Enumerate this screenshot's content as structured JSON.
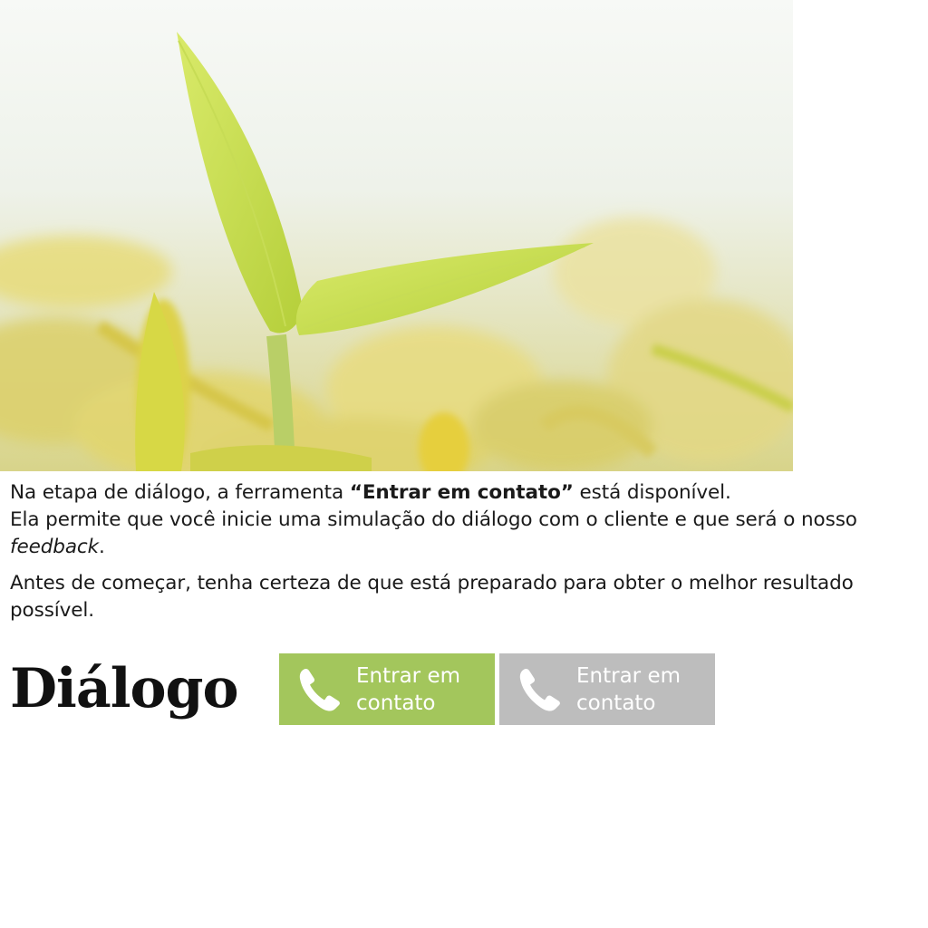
{
  "hero_image": {
    "alt": ""
  },
  "intro": {
    "line1_prefix": "Na etapa de diálogo, a ferramenta ",
    "line1_bold": "“Entrar em contato”",
    "line1_suffix": " está disponível.",
    "line2_prefix": "Ela permite que você inicie uma simulação do diálogo com o cliente e que será o nosso ",
    "line2_italic": "feedback",
    "line2_suffix": ".",
    "paragraph2": "Antes de começar, tenha certeza de que está preparado para obter o melhor resultado possível."
  },
  "section_title": "Diálogo",
  "buttons": [
    {
      "label": "Entrar em contato",
      "icon": "phone-icon",
      "state": "enabled",
      "color": "#a3c65c"
    },
    {
      "label": "Entrar em contato",
      "icon": "phone-icon",
      "state": "disabled",
      "color": "#bdbdbd"
    }
  ]
}
